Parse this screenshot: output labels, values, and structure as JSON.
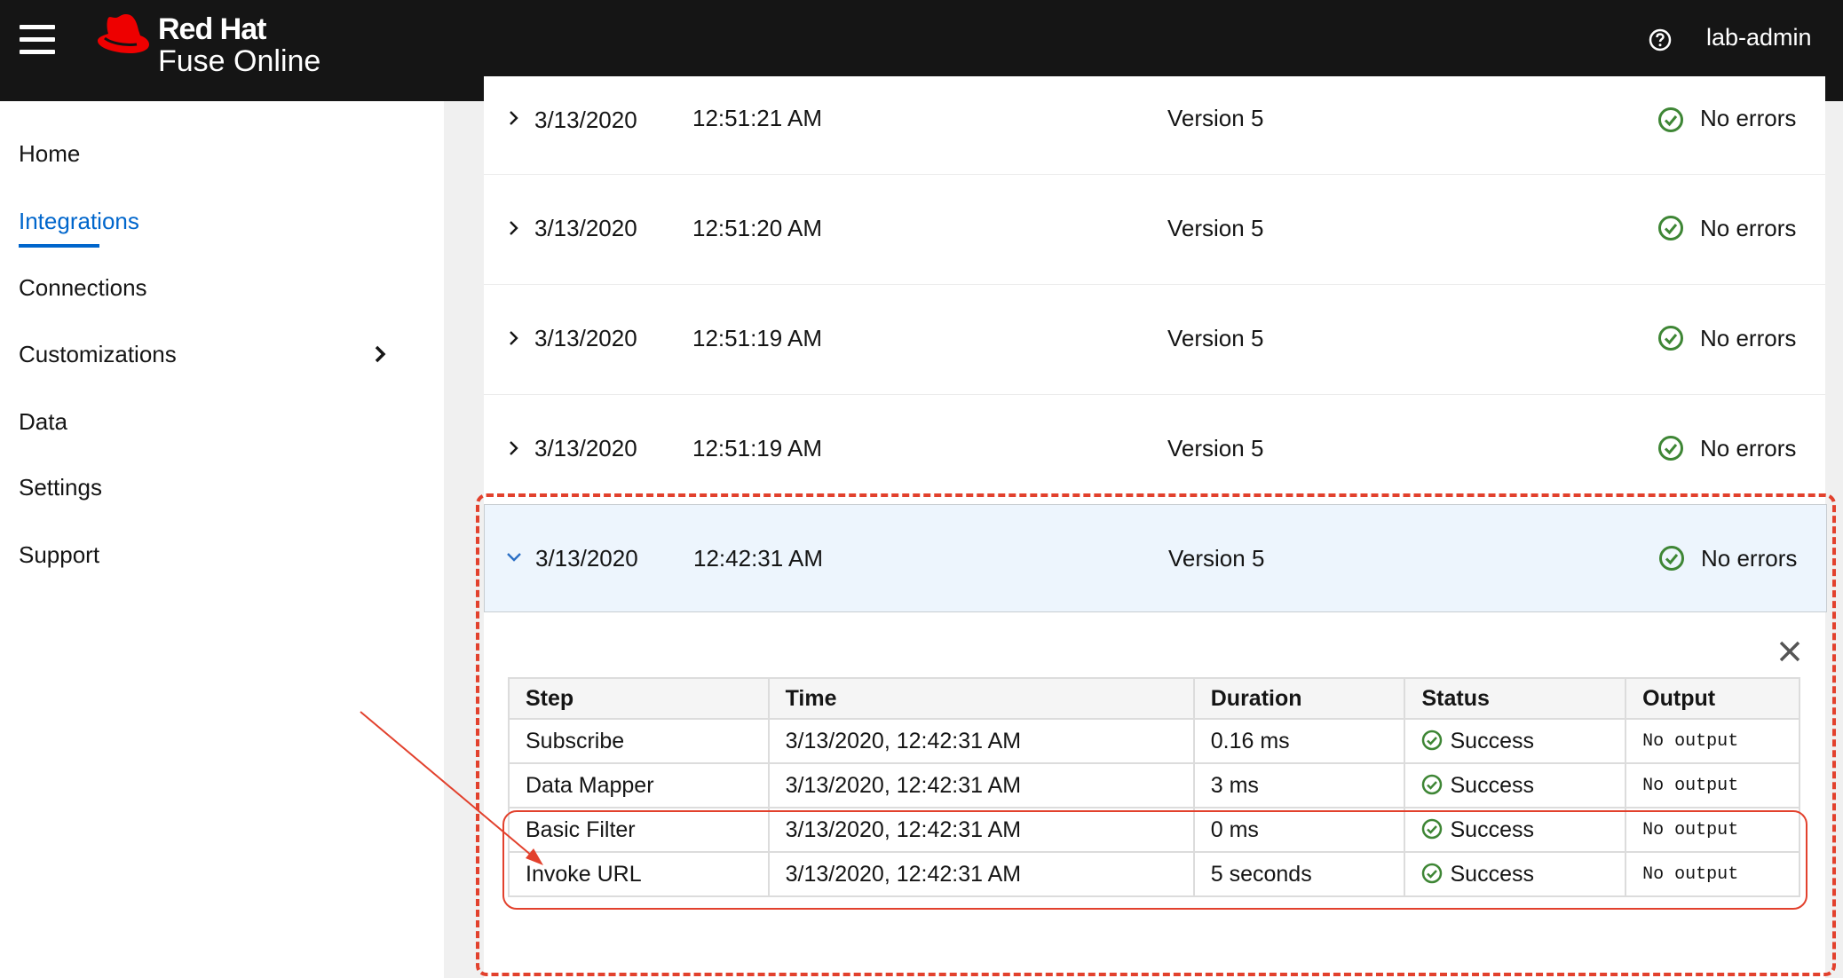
{
  "masthead": {
    "brand_line1": "Red Hat",
    "brand_line2": "Fuse Online",
    "help_icon": "question-circle-icon",
    "user": "lab-admin"
  },
  "sidebar": {
    "items": [
      {
        "label": "Home"
      },
      {
        "label": "Integrations",
        "active": true
      },
      {
        "label": "Connections"
      },
      {
        "label": "Customizations",
        "has_submenu": true
      },
      {
        "label": "Data"
      },
      {
        "label": "Settings"
      },
      {
        "label": "Support"
      }
    ],
    "accent_color": "#0066cc"
  },
  "activity": {
    "rows": [
      {
        "date": "3/13/2020",
        "time": "12:51:21 AM",
        "version": "Version 5",
        "status": "No errors"
      },
      {
        "date": "3/13/2020",
        "time": "12:51:20 AM",
        "version": "Version 5",
        "status": "No errors"
      },
      {
        "date": "3/13/2020",
        "time": "12:51:19 AM",
        "version": "Version 5",
        "status": "No errors"
      },
      {
        "date": "3/13/2020",
        "time": "12:51:19 AM",
        "version": "Version 5",
        "status": "No errors"
      },
      {
        "date": "3/13/2020",
        "time": "12:42:31 AM",
        "version": "Version 5",
        "status": "No errors",
        "expanded": true
      }
    ],
    "success_color": "#3e8635"
  },
  "steps_table": {
    "headers": [
      "Step",
      "Time",
      "Duration",
      "Status",
      "Output"
    ],
    "rows": [
      {
        "step": "Subscribe",
        "time": "3/13/2020, 12:42:31 AM",
        "duration": "0.16 ms",
        "status": "Success",
        "output": "No output"
      },
      {
        "step": "Data Mapper",
        "time": "3/13/2020, 12:42:31 AM",
        "duration": "3 ms",
        "status": "Success",
        "output": "No output"
      },
      {
        "step": "Basic Filter",
        "time": "3/13/2020, 12:42:31 AM",
        "duration": "0 ms",
        "status": "Success",
        "output": "No output"
      },
      {
        "step": "Invoke URL",
        "time": "3/13/2020, 12:42:31 AM",
        "duration": "5 seconds",
        "status": "Success",
        "output": "No output"
      }
    ]
  },
  "annotation_color": "#e2412d"
}
